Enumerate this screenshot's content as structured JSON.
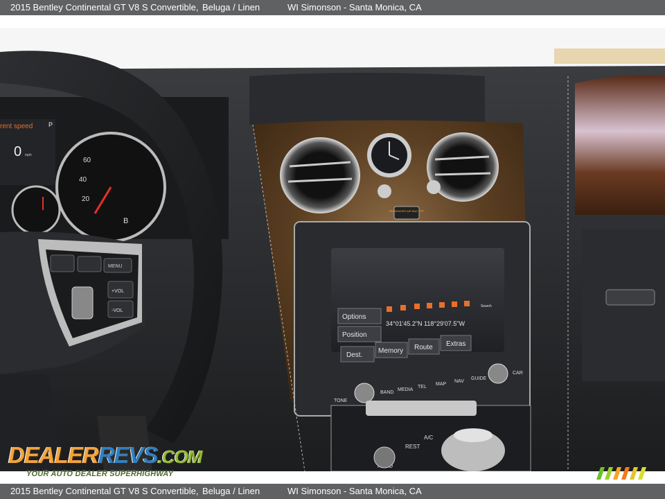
{
  "caption": {
    "model": "2015 Bentley Continental GT V8 S Convertible,",
    "color": "Beluga / Linen",
    "dealer": "WI Simonson - Santa Monica, CA"
  },
  "watermark": {
    "logo_dealer": "DEALER",
    "logo_revs": "REVS",
    "logo_com": ".COM",
    "tagline": "YOUR AUTO DEALER SUPERHIGHWAY"
  },
  "cluster": {
    "readout_label": "rent speed",
    "readout_value": "0",
    "readout_unit": "mph",
    "gear": "P",
    "tach_ticks": [
      "20",
      "40",
      "60"
    ],
    "tach_logo": "B"
  },
  "steering": {
    "vol_up": "+VOL",
    "vol_down": "-VOL",
    "menu": "MENU"
  },
  "console": {
    "airbag_label": "PASSENGER AIR BAG OFF",
    "menu_items": [
      "Options",
      "Position"
    ],
    "bottom_items": [
      "Dest.",
      "Memory",
      "Route",
      "Extras"
    ],
    "coordinates": "34°01'45.2\"N 118°29'07.5\"W",
    "search_label": "Search",
    "hard_buttons": [
      "TONE",
      "BAND",
      "MEDIA",
      "TEL",
      "MAP",
      "NAV",
      "GUIDE",
      "CAR"
    ],
    "climate_labels": [
      "REST",
      "A/C",
      "AUTO"
    ]
  },
  "colors": {
    "caption_bg": "#5f6163",
    "screen_orange": "#e8702a"
  }
}
